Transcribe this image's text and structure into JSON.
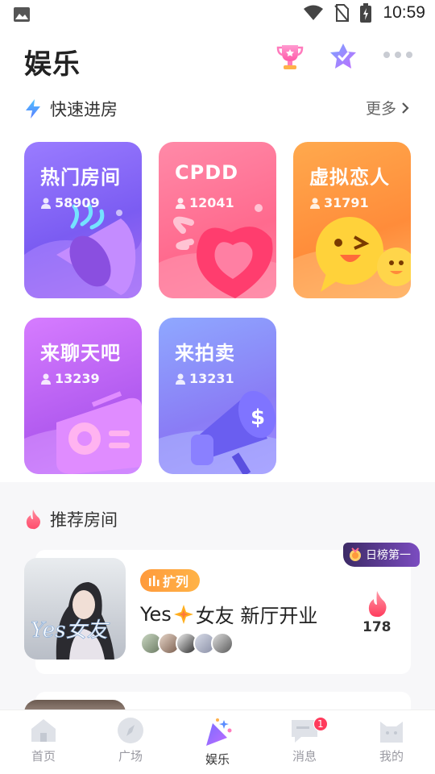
{
  "status_bar": {
    "time": "10:59"
  },
  "header": {
    "title": "娱乐"
  },
  "quick_entry": {
    "title": "快速进房",
    "more_label": "更多",
    "cards": [
      {
        "name": "热门房间",
        "count": "58909"
      },
      {
        "name": "CPDD",
        "count": "12041"
      },
      {
        "name": "虚拟恋人",
        "count": "31791"
      },
      {
        "name": "来聊天吧",
        "count": "13239"
      },
      {
        "name": "来拍卖",
        "count": "13231"
      }
    ]
  },
  "recommend": {
    "title": "推荐房间",
    "room": {
      "rank_badge": "日榜第一",
      "tag": "扩列",
      "title_part1": "Yes",
      "title_part2": "女友 新厅开业",
      "cover_text": "Yes女友",
      "heat": "178"
    }
  },
  "tabbar": {
    "items": [
      {
        "label": "首页"
      },
      {
        "label": "广场"
      },
      {
        "label": "娱乐"
      },
      {
        "label": "消息",
        "badge": "1"
      },
      {
        "label": "我的"
      }
    ]
  },
  "colors": {
    "card1": "#8a6cf5",
    "card2": "#ff6f8f",
    "card3": "#ff9e3d",
    "card4": "#c46cf0",
    "card5": "#8c8cf5"
  }
}
